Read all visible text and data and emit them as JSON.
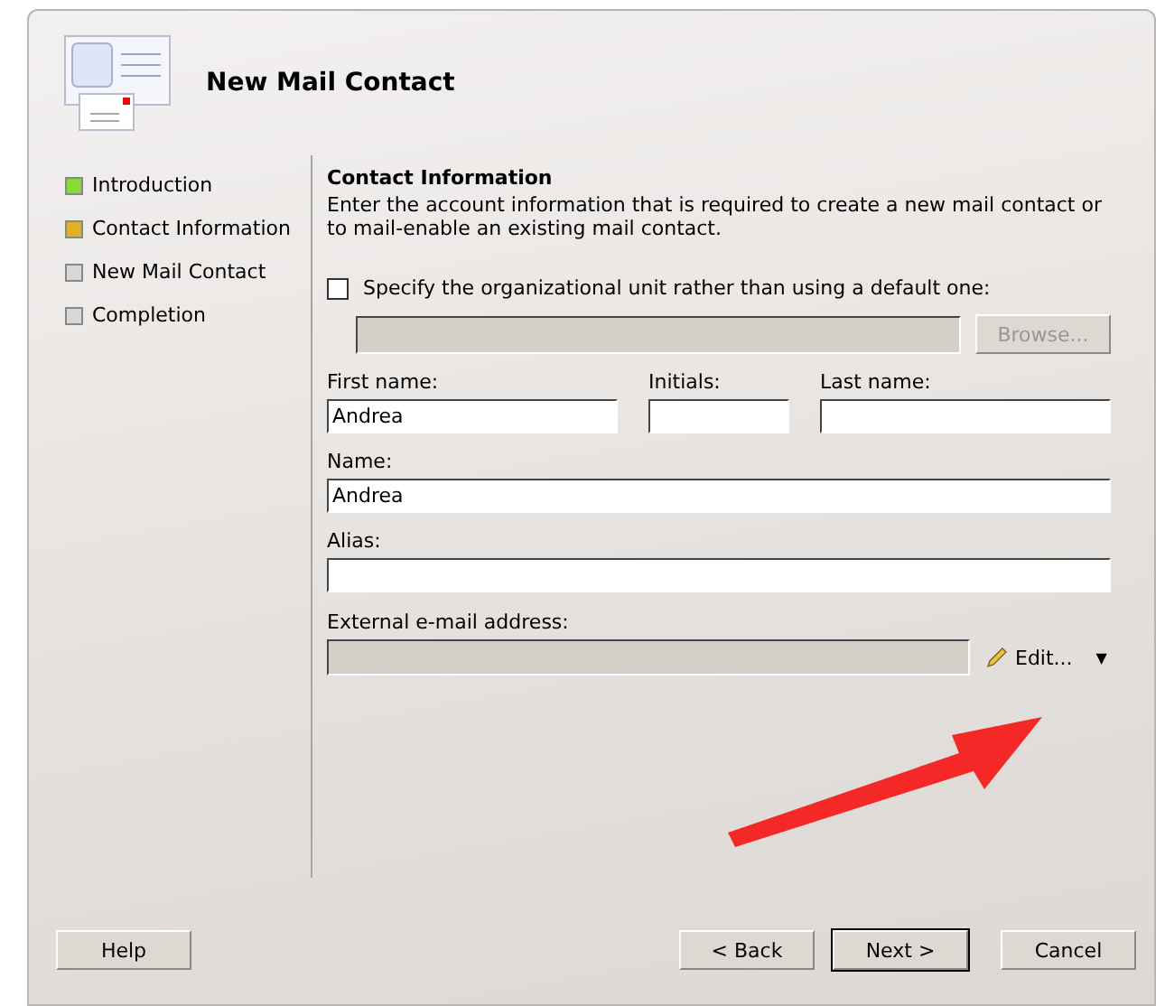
{
  "window": {
    "title": "New Mail Contact"
  },
  "steps": [
    {
      "label": "Introduction",
      "color": "#8ad83a"
    },
    {
      "label": "Contact Information",
      "color": "#e0b420"
    },
    {
      "label": "New Mail Contact",
      "color": "#d8d8d8"
    },
    {
      "label": "Completion",
      "color": "#d8d8d8"
    }
  ],
  "section": {
    "title": "Contact Information",
    "description": "Enter the account information that is required to create a new mail contact or to mail-enable an existing mail contact."
  },
  "ou": {
    "label": "Specify the organizational unit rather than using a default one:",
    "checked": false,
    "value_disabled": true,
    "browse": "Browse...",
    "browse_disabled": true
  },
  "fields": {
    "first_name": {
      "label": "First name:",
      "value": "Andrea"
    },
    "initials": {
      "label": "Initials:"
    },
    "last_name": {
      "label": "Last name:"
    },
    "name": {
      "label": "Name:",
      "value": "Andrea"
    },
    "alias": {
      "label": "Alias:"
    }
  },
  "external": {
    "label": "External e-mail address:",
    "disabled": true,
    "edit": "Edit...",
    "dropdown": "▼"
  },
  "buttons": {
    "help": "Help",
    "back": "< Back",
    "next": "Next >",
    "cancel": "Cancel"
  }
}
